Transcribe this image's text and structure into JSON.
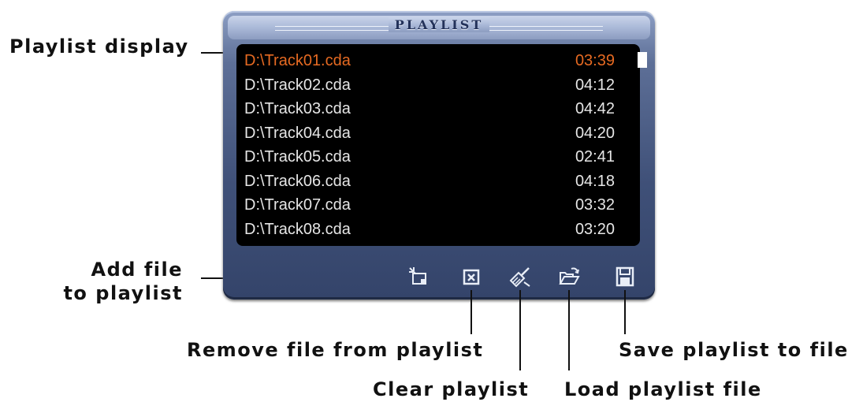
{
  "panel": {
    "title": "PLAYLIST"
  },
  "tracks": [
    {
      "name": "D:\\Track01.cda",
      "duration": "03:39"
    },
    {
      "name": "D:\\Track02.cda",
      "duration": "04:12"
    },
    {
      "name": "D:\\Track03.cda",
      "duration": "04:42"
    },
    {
      "name": "D:\\Track04.cda",
      "duration": "04:20"
    },
    {
      "name": "D:\\Track05.cda",
      "duration": "02:41"
    },
    {
      "name": "D:\\Track06.cda",
      "duration": "04:18"
    },
    {
      "name": "D:\\Track07.cda",
      "duration": "03:32"
    },
    {
      "name": "D:\\Track08.cda",
      "duration": "03:20"
    }
  ],
  "buttons": [
    {
      "id": "add",
      "icon": "add-file-icon"
    },
    {
      "id": "remove",
      "icon": "remove-file-icon"
    },
    {
      "id": "clear",
      "icon": "clear-broom-icon"
    },
    {
      "id": "load",
      "icon": "open-folder-icon"
    },
    {
      "id": "save",
      "icon": "floppy-disk-icon"
    }
  ],
  "callouts": {
    "playlist_display": "Playlist display",
    "add_file_line1": "Add file",
    "add_file_line2": "to playlist",
    "remove_file": "Remove file from playlist",
    "clear_playlist": "Clear playlist",
    "load_playlist": "Load playlist file",
    "save_playlist": "Save playlist to file"
  },
  "colors": {
    "active_track": "#e66a22",
    "track_text": "#e6e6e6",
    "list_bg": "#000000",
    "panel": "#3f5078"
  }
}
